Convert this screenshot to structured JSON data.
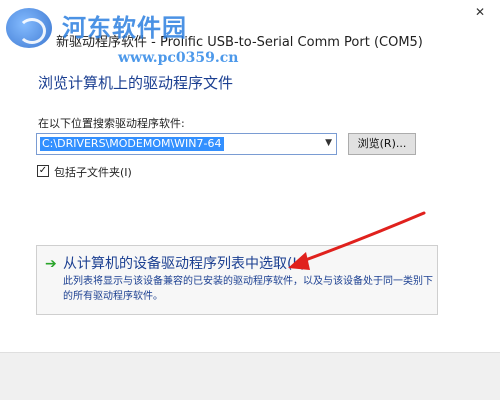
{
  "window": {
    "title": "新驱动程序软件 - Prolific USB-to-Serial Comm Port (COM5)",
    "close_glyph": "✕"
  },
  "watermark": {
    "brand": "河东软件园",
    "url": "www.pc0359.cn"
  },
  "heading": "浏览计算机上的驱动程序文件",
  "search": {
    "label": "在以下位置搜索驱动程序软件:",
    "path_value": "C:\\DRIVERS\\MODEMOM\\WIN7-64",
    "dropdown_icon": "chevron-down-icon",
    "browse_label": "浏览(R)..."
  },
  "include_subfolders": {
    "label": "包括子文件夹(I)",
    "checked": true
  },
  "command_link": {
    "title": "从计算机的设备驱动程序列表中选取(L)",
    "description": "此列表将显示与该设备兼容的已安装的驱动程序软件，以及与该设备处于同一类别下的所有驱动程序软件。",
    "icon": "green-arrow-icon"
  },
  "colors": {
    "heading_blue": "#1b3f91",
    "selection_blue": "#3390ff",
    "annotation_red": "#e0211d",
    "watermark_blue": "#2c7fe0"
  }
}
